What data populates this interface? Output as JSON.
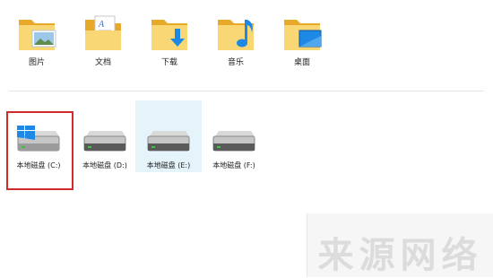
{
  "folders": [
    {
      "label": "图片",
      "icon": "pictures-folder-icon"
    },
    {
      "label": "文档",
      "icon": "documents-folder-icon"
    },
    {
      "label": "下载",
      "icon": "downloads-folder-icon"
    },
    {
      "label": "音乐",
      "icon": "music-folder-icon"
    },
    {
      "label": "桌面",
      "icon": "desktop-folder-icon"
    }
  ],
  "drives": [
    {
      "label": "本地磁盘 (C:)",
      "icon": "windows-drive-icon",
      "selected": true
    },
    {
      "label": "本地磁盘 (D:)",
      "icon": "hard-drive-icon"
    },
    {
      "label": "本地磁盘 (E:)",
      "icon": "hard-drive-icon",
      "hovered": true
    },
    {
      "label": "本地磁盘 (F:)",
      "icon": "hard-drive-icon"
    }
  ],
  "watermark": {
    "text": "来源网络"
  },
  "colors": {
    "folder": "#f5c84b",
    "selection_border": "#d22a2a",
    "hover_bg": "#e5f3fb",
    "accent_blue": "#1e88e5"
  }
}
